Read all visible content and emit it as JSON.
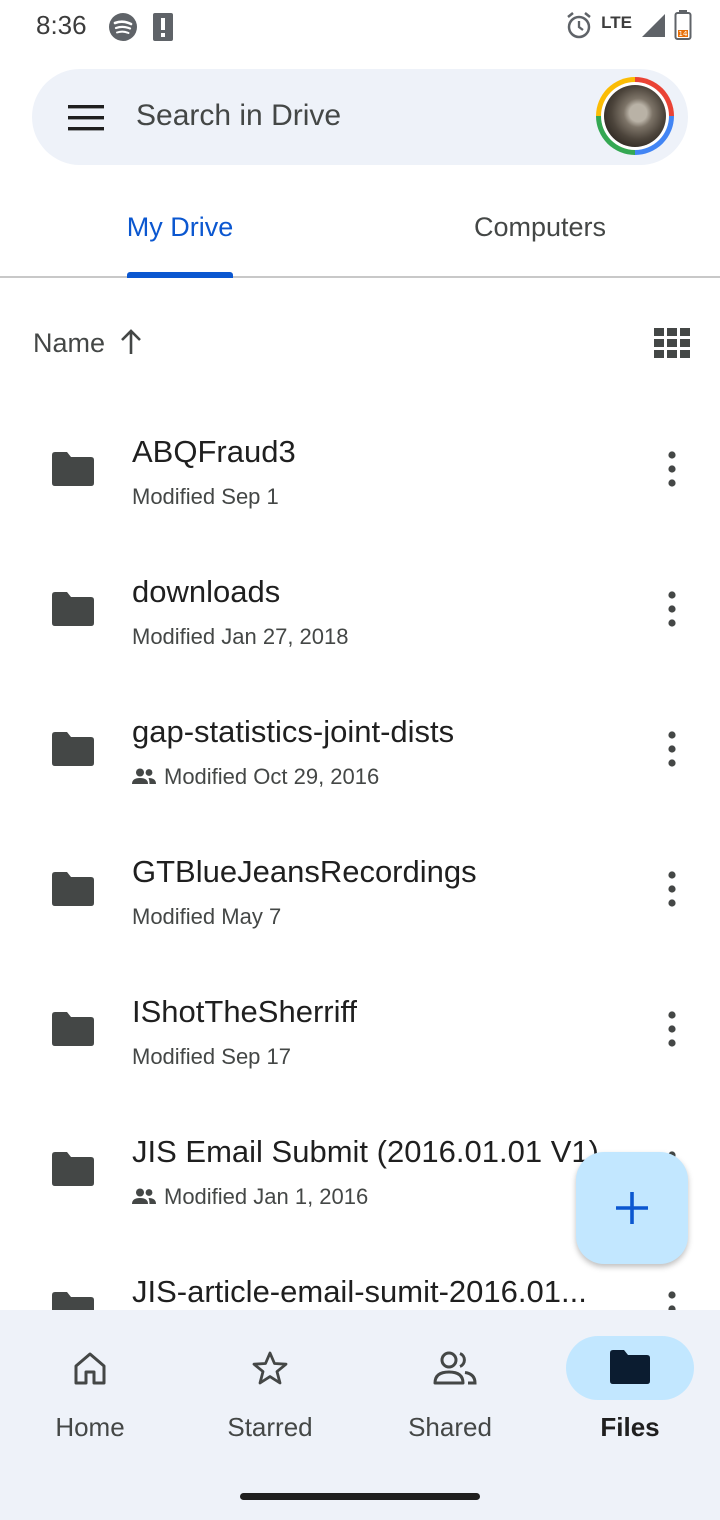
{
  "status_bar": {
    "time": "8:36",
    "network": "LTE",
    "battery_level": "14"
  },
  "search": {
    "placeholder": "Search in Drive"
  },
  "tabs": [
    {
      "label": "My Drive",
      "active": true
    },
    {
      "label": "Computers",
      "active": false
    }
  ],
  "sort": {
    "label": "Name"
  },
  "files": [
    {
      "name": "ABQFraud3",
      "modified": "Modified Sep 1",
      "shared": false
    },
    {
      "name": "downloads",
      "modified": "Modified Jan 27, 2018",
      "shared": false
    },
    {
      "name": "gap-statistics-joint-dists",
      "modified": "Modified Oct 29, 2016",
      "shared": true
    },
    {
      "name": "GTBlueJeansRecordings",
      "modified": "Modified May 7",
      "shared": false
    },
    {
      "name": "IShotTheSherriff",
      "modified": "Modified Sep 17",
      "shared": false
    },
    {
      "name": "JIS Email Submit (2016.01.01 V1)",
      "modified": "Modified Jan 1, 2016",
      "shared": true
    },
    {
      "name": "JIS-article-email-sumit-2016.01...",
      "modified": "",
      "shared": false
    }
  ],
  "bottom_nav": [
    {
      "label": "Home",
      "icon": "home-icon",
      "active": false
    },
    {
      "label": "Starred",
      "icon": "star-icon",
      "active": false
    },
    {
      "label": "Shared",
      "icon": "people-icon",
      "active": false
    },
    {
      "label": "Files",
      "icon": "folder-icon",
      "active": true
    }
  ],
  "colors": {
    "accent": "#0b57d0",
    "surface": "#eef2f9",
    "fab": "#c2e7ff"
  }
}
